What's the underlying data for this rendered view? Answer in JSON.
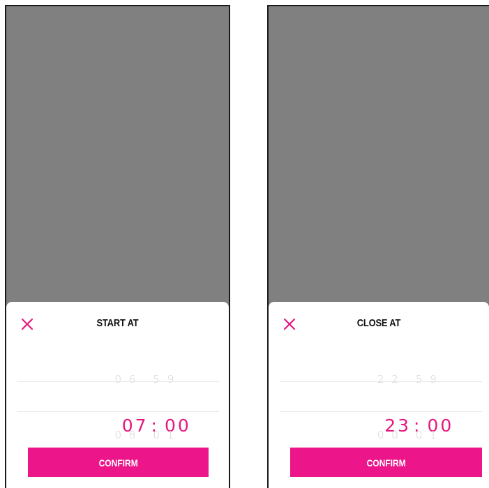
{
  "colors": {
    "accent": "#ec168a",
    "selected_text": "#e6177f",
    "backdrop": "#7f807f",
    "dim_text": "#cfcfcf"
  },
  "screens": [
    {
      "title": "START AT",
      "close_icon": "close-x-icon",
      "picker": {
        "prev": {
          "hour": "0 6",
          "minute": "5 9"
        },
        "selected": {
          "hour": "07",
          "separator": ":",
          "minute": "00"
        },
        "next": {
          "hour": "0 8",
          "minute": "0 1"
        }
      },
      "confirm_label": "CONFIRM"
    },
    {
      "title": "CLOSE AT",
      "close_icon": "close-x-icon",
      "picker": {
        "prev": {
          "hour": "2 2",
          "minute": "5 9"
        },
        "selected": {
          "hour": "23",
          "separator": ":",
          "minute": "00"
        },
        "next": {
          "hour": "0 0",
          "minute": "0 1"
        }
      },
      "confirm_label": "CONFIRM"
    }
  ]
}
